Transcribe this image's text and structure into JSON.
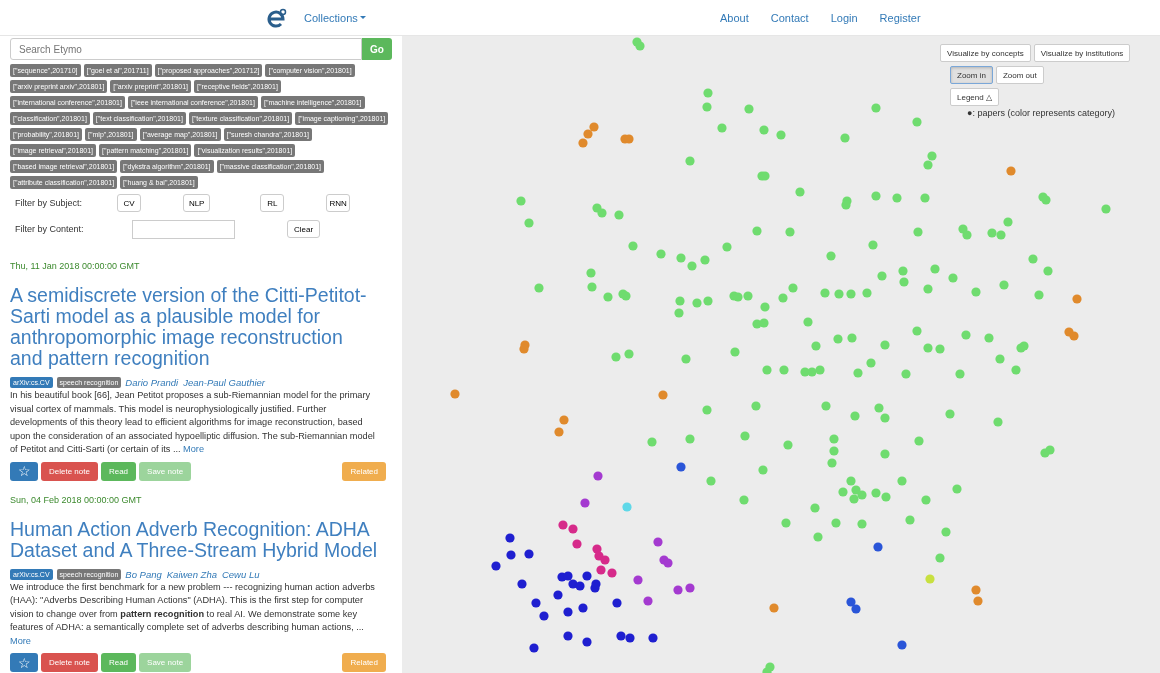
{
  "header": {
    "collections": "Collections",
    "nav": [
      "About",
      "Contact",
      "Login",
      "Register"
    ]
  },
  "search": {
    "placeholder": "Search Etymo",
    "button": "Go"
  },
  "tags": [
    "[\"sequence\",201710]",
    "[\"goel et al\",201711]",
    "[\"proposed approaches\",201712]",
    "[\"computer vision\",201801]",
    "[\"arxiv preprint arxiv\",201801]",
    "[\"arxiv preprint\",201801]",
    "[\"receptive fields\",201801]",
    "[\"international conference\",201801]",
    "[\"ieee international conference\",201801]",
    "[\"machine intelligence\",201801]",
    "[\"classification\",201801]",
    "[\"text classification\",201801]",
    "[\"texture classification\",201801]",
    "[\"image captioning\",201801]",
    "[\"probability\",201801]",
    "[\"mlp\",201801]",
    "[\"average map\",201801]",
    "[\"suresh chandra\",201801]",
    "[\"image retrieval\",201801]",
    "[\"pattern matching\",201801]",
    "[\"visualization results\",201801]",
    "[\"based image retrieval\",201801]",
    "[\"dykstra algorithm\",201801]",
    "[\"massive classification\",201801]",
    "[\"attribute classification\",201801]",
    "[\"huang & bai\",201801]"
  ],
  "filters": {
    "subject_label": "Filter by Subject:",
    "subjects": [
      "CV",
      "NLP",
      "RL",
      "RNN"
    ],
    "content_label": "Filter by Content:",
    "clear": "Clear"
  },
  "papers": [
    {
      "date": "Thu, 11 Jan 2018 00:00:00 GMT",
      "title": "A semidiscrete version of the Citti-Petitot-Sarti model as a plausible model for anthropomorphic image reconstruction and pattern recognition",
      "badges": [
        {
          "text": "arXiv:cs.CV",
          "kind": "category"
        },
        {
          "text": "speech recognition",
          "kind": "tag"
        }
      ],
      "authors": [
        "Dario Prandi",
        "Jean-Paul Gauthier"
      ],
      "abstract": "In his beautiful book [66], Jean Petitot proposes a sub-Riemannian model for the primary visual cortex of mammals. This model is neurophysiologically justified. Further developments of this theory lead to efficient algorithms for image reconstruction, based upon the consideration of an associated hypoelliptic diffusion. The sub-Riemannian model of Petitot and Citti-Sarti (or certain of its ...",
      "more": "More",
      "actions": [
        {
          "kind": "star",
          "label": "☆",
          "disabled": false
        },
        {
          "kind": "danger",
          "label": "Delete note",
          "disabled": false
        },
        {
          "kind": "success",
          "label": "Read",
          "disabled": false
        },
        {
          "kind": "success",
          "label": "Save note",
          "disabled": true
        },
        {
          "kind": "warning",
          "label": "Related",
          "disabled": false
        }
      ]
    },
    {
      "date": "Sun, 04 Feb 2018 00:00:00 GMT",
      "title": "Human Action Adverb Recognition: ADHA Dataset and A Three-Stream Hybrid Model",
      "badges": [
        {
          "text": "arXiv:cs.CV",
          "kind": "category"
        },
        {
          "text": "speech recognition",
          "kind": "tag"
        }
      ],
      "authors": [
        "Bo Pang",
        "Kaiwen Zha",
        "Cewu Lu"
      ],
      "abstract": "We introduce the first benchmark for a new problem --- recognizing human action adverbs (HAA): \"Adverbs Describing Human Actions\" (ADHA). This is the first step for computer vision to change over from **pattern recognition** to real AI. We demonstrate some key features of ADHA: a semantically complete set of adverbs describing human actions, ...",
      "more": "More",
      "actions": [
        {
          "kind": "star",
          "label": "☆",
          "disabled": false
        },
        {
          "kind": "danger",
          "label": "Delete note",
          "disabled": false
        },
        {
          "kind": "success",
          "label": "Read",
          "disabled": false
        },
        {
          "kind": "success",
          "label": "Save note",
          "disabled": true
        },
        {
          "kind": "warning",
          "label": "Related",
          "disabled": false
        }
      ]
    }
  ],
  "viz": {
    "modes": [
      {
        "label": "Visualize by concepts",
        "selected": false
      },
      {
        "label": "Visualize by institutions",
        "selected": false
      }
    ],
    "zoom": [
      {
        "label": "Zoom in",
        "selected": true
      },
      {
        "label": "Zoom out",
        "selected": false
      }
    ],
    "legend_button": "Legend △",
    "legend_text": "●: papers (color represents category)"
  }
}
